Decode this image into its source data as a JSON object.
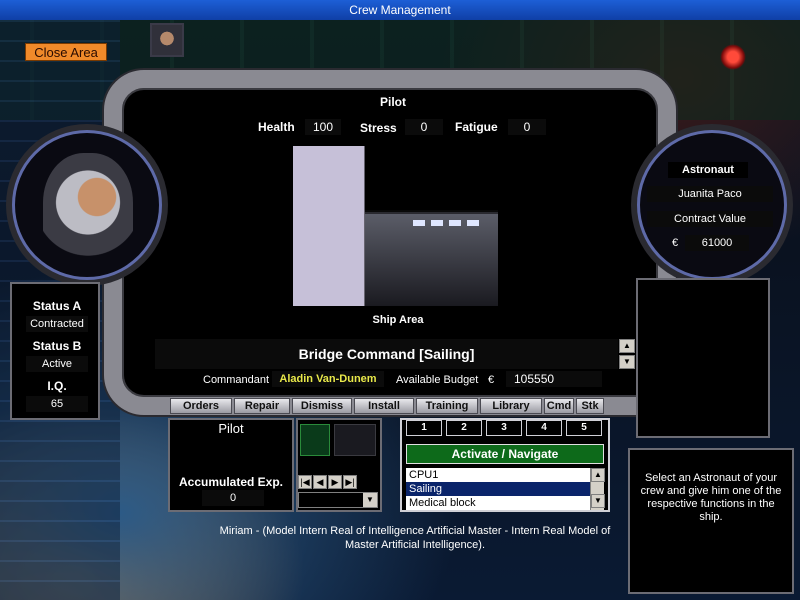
{
  "window": {
    "title": "Crew Management"
  },
  "top": {
    "close_area": "Close Area"
  },
  "pilot_panel": {
    "role_title": "Pilot",
    "health_label": "Health",
    "health_value": "100",
    "stress_label": "Stress",
    "stress_value": "0",
    "fatigue_label": "Fatigue",
    "fatigue_value": "0",
    "ship_area_label": "Ship Area",
    "ship_area_value": "Bridge Command [Sailing]",
    "commandant_label": "Commandant",
    "commandant_value": "Aladin Van-Dunem",
    "budget_label": "Available Budget",
    "budget_currency": "€",
    "budget_value": "105550"
  },
  "astronaut": {
    "heading": "Astronaut",
    "name": "Juanita Paco",
    "contract_label": "Contract Value",
    "contract_currency": "€",
    "contract_value": "61000"
  },
  "status": {
    "a_label": "Status A",
    "a_value": "Contracted",
    "b_label": "Status B",
    "b_value": "Active",
    "iq_label": "I.Q.",
    "iq_value": "65"
  },
  "toolbar": [
    "Orders",
    "Repair",
    "Dismiss",
    "Install",
    "Training",
    "Library",
    "Cmd",
    "Stk"
  ],
  "crew_box": {
    "role": "Pilot",
    "exp_label": "Accumulated Exp.",
    "exp_value": "0"
  },
  "action_box": {
    "tabs": [
      "1",
      "2",
      "3",
      "4",
      "5"
    ],
    "action": "Activate / Navigate",
    "list": [
      "CPU1",
      "Sailing",
      "Medical block"
    ],
    "selected_index": 1
  },
  "info": {
    "ai_message": "Miriam - (Model Intern Real of Intelligence Artificial Master - Intern Real Model of Master Artificial Intelligence).",
    "help_text": "Select an Astronaut of your crew and give him one of the respective functions in the ship."
  },
  "colors": {
    "close_area": "#f08a2a",
    "action_green": "#0d6a1a",
    "commandant_yellow": "#e8e84a"
  }
}
